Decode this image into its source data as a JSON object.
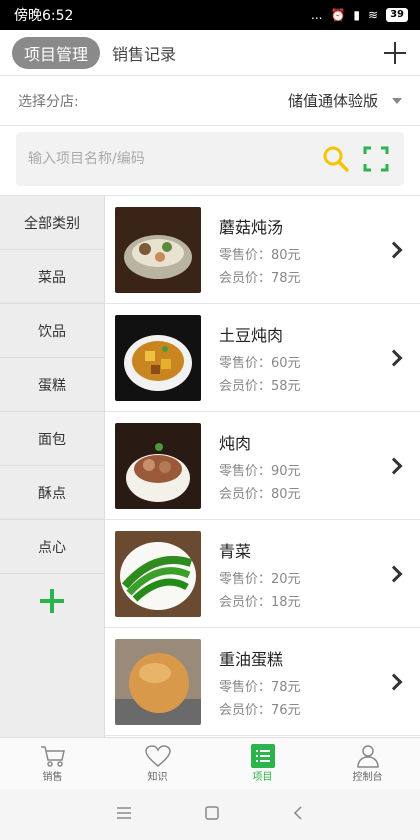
{
  "status": {
    "time": "傍晚6:52",
    "signal_text": "...",
    "battery": "39"
  },
  "header": {
    "tab_active": "项目管理",
    "tab_inactive": "销售记录"
  },
  "branch": {
    "label": "选择分店:",
    "value": "储值通体验版"
  },
  "search": {
    "placeholder": "输入项目名称/编码"
  },
  "sidebar": {
    "items": [
      {
        "label": "全部类别"
      },
      {
        "label": "菜品"
      },
      {
        "label": "饮品"
      },
      {
        "label": "蛋糕"
      },
      {
        "label": "面包"
      },
      {
        "label": "酥点"
      },
      {
        "label": "点心"
      }
    ]
  },
  "products": [
    {
      "name": "蘑菇炖汤",
      "retail": "零售价：80元",
      "member": "会员价：78元"
    },
    {
      "name": "土豆炖肉",
      "retail": "零售价：60元",
      "member": "会员价：58元"
    },
    {
      "name": "炖肉",
      "retail": "零售价：90元",
      "member": "会员价：80元"
    },
    {
      "name": "青菜",
      "retail": "零售价：20元",
      "member": "会员价：18元"
    },
    {
      "name": "重油蛋糕",
      "retail": "零售价：78元",
      "member": "会员价：76元"
    }
  ],
  "nav": {
    "items": [
      {
        "label": "销售",
        "icon": "cart-icon"
      },
      {
        "label": "知识",
        "icon": "heart-icon"
      },
      {
        "label": "项目",
        "icon": "list-icon",
        "active": true
      },
      {
        "label": "控制台",
        "icon": "person-icon"
      }
    ]
  },
  "colors": {
    "accent": "#2bb44c",
    "scan": "#f5c400"
  }
}
